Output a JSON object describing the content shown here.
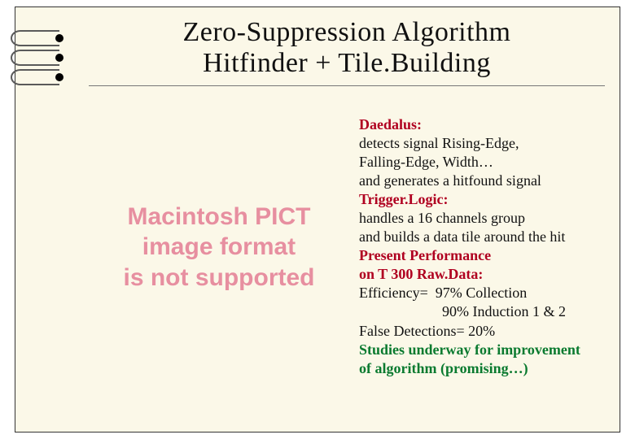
{
  "title": {
    "line1": "Zero-Suppression Algorithm",
    "line2": "Hitfinder  +  Tile.Building"
  },
  "left_placeholder": {
    "line1": "Macintosh PICT",
    "line2": "image format",
    "line3": "is not supported"
  },
  "sections": {
    "daedalus": {
      "heading": "Daedalus:",
      "line1": "detects signal Rising-Edge,",
      "line2": "Falling-Edge, Width…",
      "line3": "and generates a hitfound signal"
    },
    "trigger": {
      "heading": "Trigger.Logic:",
      "line1": "handles a 16 channels group",
      "line2": "and builds a data tile around the hit"
    },
    "performance": {
      "heading_line1": "Present Performance",
      "heading_line2": "on T 300 Raw.Data:",
      "eff_label": "Efficiency=",
      "eff_val1": "97%  Collection",
      "eff_val2": "90%  Induction 1 & 2",
      "false_det": "False Detections= 20%"
    },
    "studies": {
      "line1": "Studies underway for improvement",
      "line2": "of algorithm (promising…)"
    }
  }
}
